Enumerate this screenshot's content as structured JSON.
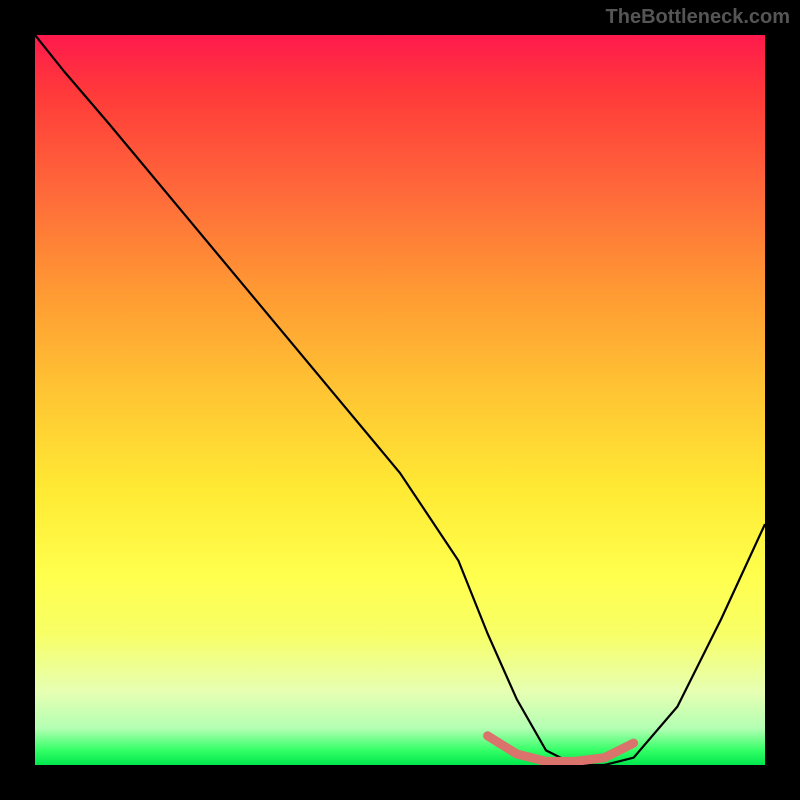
{
  "watermark": "TheBottleneck.com",
  "chart_data": {
    "type": "line",
    "title": "",
    "xlabel": "",
    "ylabel": "",
    "xlim": [
      0,
      100
    ],
    "ylim": [
      0,
      100
    ],
    "series": [
      {
        "name": "main-curve",
        "color": "#000000",
        "x": [
          0,
          4,
          10,
          20,
          30,
          40,
          50,
          58,
          62,
          66,
          70,
          74,
          78,
          82,
          88,
          94,
          100
        ],
        "y": [
          100,
          95,
          88,
          76,
          64,
          52,
          40,
          28,
          18,
          9,
          2,
          0,
          0,
          1,
          8,
          20,
          33
        ]
      },
      {
        "name": "highlight-segment",
        "color": "#d9736b",
        "x": [
          62,
          66,
          70,
          74,
          78,
          82
        ],
        "y": [
          4,
          1.5,
          0.5,
          0.5,
          1,
          3
        ]
      }
    ]
  }
}
